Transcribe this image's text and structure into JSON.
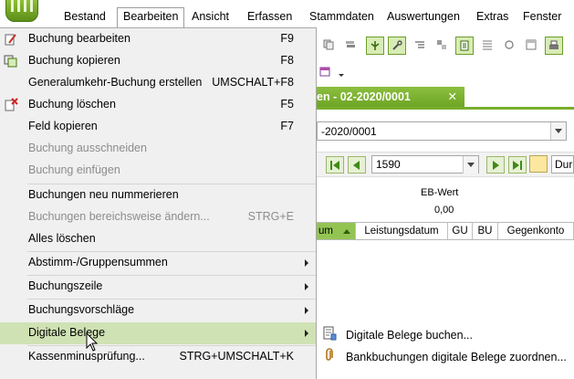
{
  "menubar": {
    "items": [
      "Bestand",
      "Bearbeiten",
      "Ansicht",
      "Erfassen",
      "Stammdaten",
      "Auswertungen",
      "Extras",
      "Fenster"
    ],
    "active": "Bearbeiten"
  },
  "document": {
    "tab_title": "en  - 02-2020/0001",
    "tab_close": "✕",
    "combo_value": "-2020/0001",
    "record_number": "1590",
    "nav_extra_text": "Durc"
  },
  "summary": {
    "eb_label": "EB-Wert",
    "eb_value": "0,00"
  },
  "grid": {
    "columns": [
      "um",
      "Leistungsdatum",
      "GU",
      "BU",
      "Gegenkonto"
    ]
  },
  "dropdown": {
    "items": [
      {
        "label": "Buchung bearbeiten",
        "shortcut": "F9",
        "icon": "edit-icon",
        "enabled": true
      },
      {
        "label": "Buchung kopieren",
        "shortcut": "F8",
        "icon": "copy-icon",
        "enabled": true
      },
      {
        "label": "Generalumkehr-Buchung erstellen",
        "shortcut": "UMSCHALT+F8",
        "icon": "",
        "enabled": true
      },
      {
        "label": "Buchung löschen",
        "shortcut": "F5",
        "icon": "delete-icon",
        "enabled": true
      },
      {
        "label": "Feld kopieren",
        "shortcut": "F7",
        "icon": "",
        "enabled": true
      },
      {
        "label": "Buchung ausschneiden",
        "shortcut": "",
        "icon": "",
        "enabled": false
      },
      {
        "label": "Buchung einfügen",
        "shortcut": "",
        "icon": "",
        "enabled": false
      },
      {
        "label": "Buchungen neu nummerieren",
        "shortcut": "",
        "icon": "",
        "enabled": true
      },
      {
        "label": "Buchungen bereichsweise ändern...",
        "shortcut": "STRG+E",
        "icon": "",
        "enabled": false
      },
      {
        "label": "Alles löschen",
        "shortcut": "",
        "icon": "",
        "enabled": true
      },
      {
        "label": "Abstimm-/Gruppensummen",
        "shortcut": "",
        "icon": "",
        "enabled": true,
        "submenu": true
      },
      {
        "label": "Buchungszeile",
        "shortcut": "",
        "icon": "",
        "enabled": true,
        "submenu": true
      },
      {
        "label": "Buchungsvorschläge",
        "shortcut": "",
        "icon": "",
        "enabled": true,
        "submenu": true
      },
      {
        "label": "Digitale Belege",
        "shortcut": "",
        "icon": "",
        "enabled": true,
        "submenu": true,
        "highlighted": true
      },
      {
        "label": "Kassenminusprüfung...",
        "shortcut": "STRG+UMSCHALT+K",
        "icon": "",
        "enabled": true
      }
    ]
  },
  "submenu": {
    "items": [
      {
        "label": "Digitale Belege buchen...",
        "icon": "document-book-icon"
      },
      {
        "label": "Bankbuchungen digitale Belege zuordnen...",
        "icon": "paperclip-icon"
      }
    ]
  },
  "colors": {
    "accent_green": "#79ae2c",
    "highlight": "#cfe2b4",
    "menu_bg": "#f0f0f0",
    "disabled_text": "#8c8c8c"
  }
}
